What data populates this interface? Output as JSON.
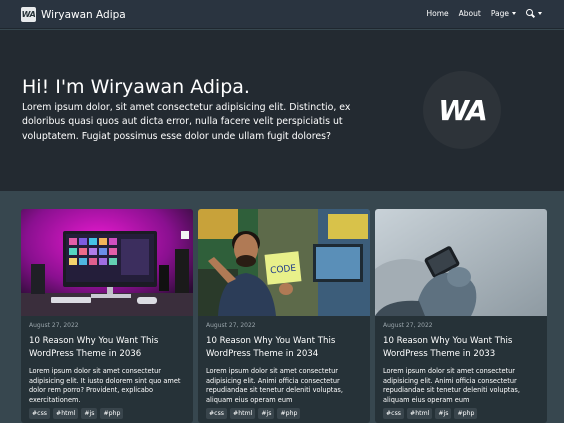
{
  "navbar": {
    "brand_logo": "WA",
    "brand_name": "Wiryawan Adipa",
    "links": [
      "Home",
      "About",
      "Page"
    ],
    "icons": [
      "search-icon",
      "chevron-down-icon"
    ]
  },
  "hero": {
    "title": "Hi! I'm Wiryawan Adipa.",
    "text": "Lorem ipsum dolor, sit amet consectetur adipisicing elit. Distinctio, ex doloribus quasi quos aut dicta error, nulla facere velit perspiciatis ut voluptatem. Fugiat possimus esse dolor unde ullam fugit dolores?",
    "logo": "WA"
  },
  "posts": [
    {
      "date": "August 27, 2022",
      "title": "10 Reason Why You Want This WordPress Theme in 2036",
      "excerpt": "Lorem ipsum dolor sit amet consectetur adipisicing elit. It iusto dolorem sint quo amet dolor rem porro? Provident, explicabo exercitationem.",
      "tags": [
        "#css",
        "#html",
        "#js",
        "#php"
      ]
    },
    {
      "date": "August 27, 2022",
      "title": "10 Reason Why You Want This WordPress Theme in 2034",
      "excerpt": "Lorem ipsum dolor sit amet consectetur adipisicing elit. Animi officia consectetur repudiandae sit tenetur deleniti voluptas, aliquam eius operam eum",
      "tags": [
        "#css",
        "#html",
        "#js",
        "#php"
      ],
      "image_text": "CODE"
    },
    {
      "date": "August 27, 2022",
      "title": "10 Reason Why You Want This WordPress Theme in 2033",
      "excerpt": "Lorem ipsum dolor sit amet consectetur adipisicing elit. Animi officia consectetur repudiandae sit tenetur deleniti voluptas, aliquam eius operam eum",
      "tags": [
        "#css",
        "#html",
        "#js",
        "#php"
      ]
    }
  ],
  "colors": {
    "navbar": "#2a3440",
    "hero": "#232a31",
    "page": "#37474f",
    "card": "#263238",
    "tag": "#39454c"
  }
}
